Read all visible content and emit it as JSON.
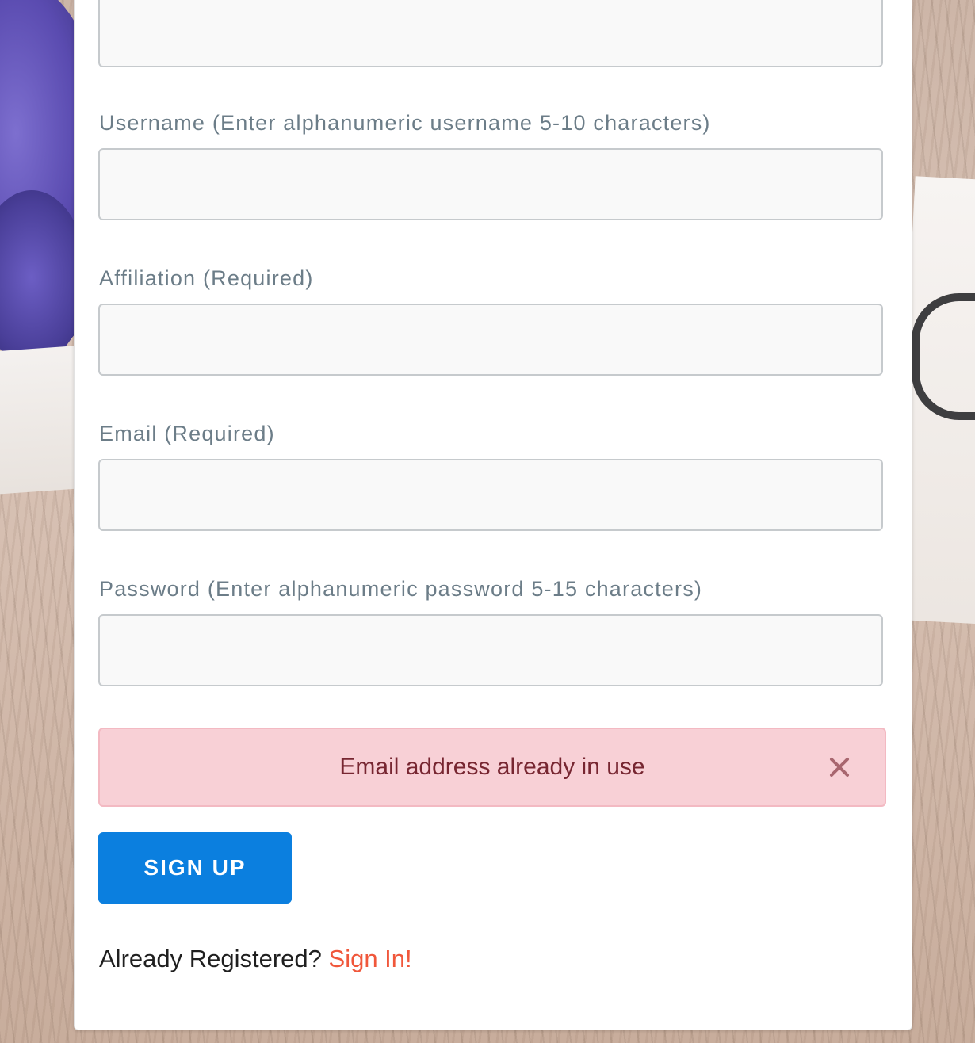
{
  "form": {
    "fields": [
      {
        "label": "",
        "value": "",
        "placeholder": ""
      },
      {
        "label": "Username (Enter alphanumeric username 5-10 characters)",
        "value": "",
        "placeholder": ""
      },
      {
        "label": "Affiliation (Required)",
        "value": "",
        "placeholder": ""
      },
      {
        "label": "Email (Required)",
        "value": "",
        "placeholder": ""
      },
      {
        "label": "Password (Enter alphanumeric password 5-15 characters)",
        "value": "",
        "placeholder": ""
      }
    ],
    "alert": {
      "message": "Email address already in use",
      "close_icon": "close-icon",
      "color": "#772631",
      "background": "#f8d0d6"
    },
    "submit_label": "SIGN UP",
    "submit_color": "#0b7fdf",
    "footer": {
      "prompt": "Already Registered?",
      "link_label": "Sign In!",
      "link_color": "#f0573b"
    }
  }
}
